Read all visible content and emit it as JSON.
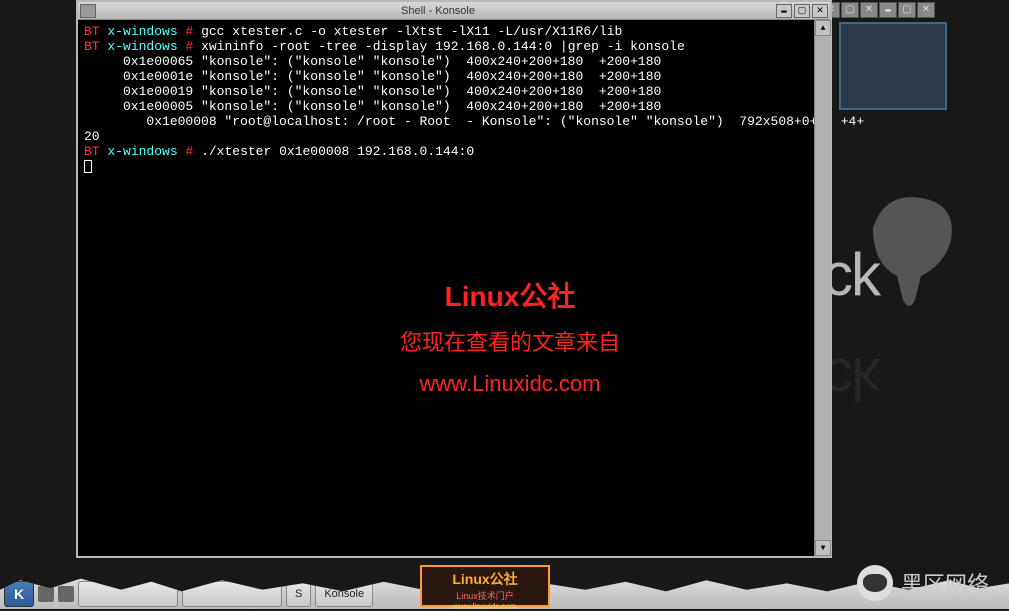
{
  "window": {
    "title": "Shell - Konsole"
  },
  "terminal": {
    "prompt_host": "BT",
    "prompt_path": "x-windows",
    "prompt_symbol": "#",
    "cmd1": "gcc xtester.c -o xtester -lXtst -lX11 -L/usr/X11R6/lib",
    "cmd2": "xwininfo -root -tree -display 192.168.0.144:0 |grep -i konsole",
    "out1": "     0x1e00065 \"konsole\": (\"konsole\" \"konsole\")  400x240+200+180  +200+180",
    "out2": "     0x1e0001e \"konsole\": (\"konsole\" \"konsole\")  400x240+200+180  +200+180",
    "out3": "     0x1e00019 \"konsole\": (\"konsole\" \"konsole\")  400x240+200+180  +200+180",
    "out4": "     0x1e00005 \"konsole\": (\"konsole\" \"konsole\")  400x240+200+180  +200+180",
    "out5": "        0x1e00008 \"root@localhost: /root - Root  - Konsole\": (\"konsole\" \"konsole\")  792x508+0+0  +4+",
    "out6": "20",
    "cmd3": "./xtester 0x1e00008 192.168.0.144:0"
  },
  "watermark": {
    "line1": "Linux公社",
    "line2": "您现在查看的文章来自",
    "line3": "www.Linuxidc.com"
  },
  "background": {
    "text_left": "<<back",
    "text_right": "track"
  },
  "taskbar": {
    "kmenu": "K",
    "items": [
      "",
      "",
      "S",
      "Konsole"
    ]
  },
  "badge": {
    "t1": "Linux公社",
    "t2": "Linux技术门户",
    "t3": "www.linuxidc.com"
  },
  "heiqu": {
    "text": "黑区网络"
  }
}
